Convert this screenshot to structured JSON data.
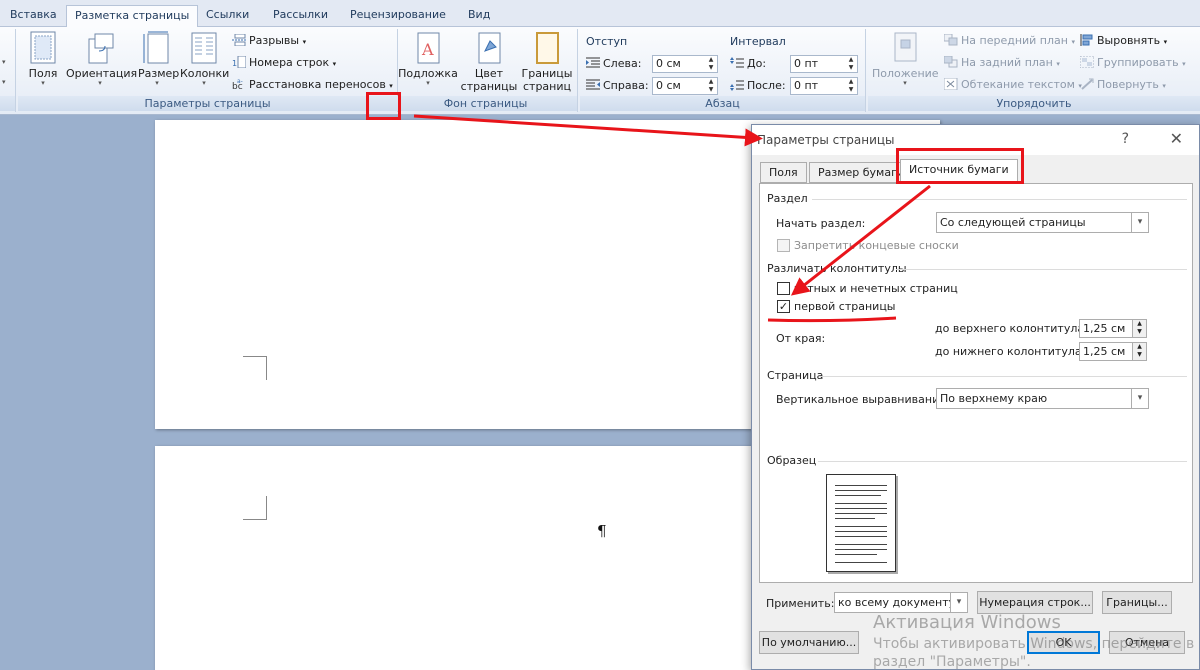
{
  "tabs": [
    "Вставка",
    "Разметка страницы",
    "Ссылки",
    "Рассылки",
    "Рецензирование",
    "Вид"
  ],
  "ribbon": {
    "page_setup": {
      "label": "Параметры страницы",
      "fields": "Поля",
      "orientation": "Ориентация",
      "size": "Размер",
      "columns": "Колонки",
      "breaks": "Разрывы",
      "line_numbers": "Номера строк",
      "hyphenation": "Расстановка переносов"
    },
    "page_background": {
      "label": "Фон страницы",
      "watermark": "Подложка",
      "page_color_1": "Цвет",
      "page_color_2": "страницы",
      "borders_1": "Границы",
      "borders_2": "страниц"
    },
    "paragraph": {
      "label": "Абзац",
      "indent_title": "Отступ",
      "left_label": "Слева:",
      "left_value": "0 см",
      "right_label": "Справа:",
      "right_value": "0 см",
      "spacing_title": "Интервал",
      "before_label": "До:",
      "before_value": "0 пт",
      "after_label": "После:",
      "after_value": "0 пт"
    },
    "arrange": {
      "label": "Упорядочить",
      "position": "Положение",
      "bring_forward": "На передний план",
      "send_backward": "На задний план",
      "text_wrap": "Обтекание текстом",
      "align": "Выровнять",
      "group": "Группировать",
      "rotate": "Повернуть"
    }
  },
  "document": {
    "pilcrow": "¶"
  },
  "dialog": {
    "title": "Параметры страницы",
    "help": "?",
    "close": "✕",
    "tabs": [
      "Поля",
      "Размер бумаги",
      "Источник бумаги"
    ],
    "section_header": "Раздел",
    "start_section_label": "Начать раздел:",
    "start_section_value": "Со следующей страницы",
    "suppress_endnotes_label": "Запретить концевые сноски",
    "headers_header": "Различать колонтитулы",
    "odd_even_label": "четных и нечетных страниц",
    "odd_even_checked": false,
    "first_page_label": "первой страницы",
    "first_page_checked": true,
    "from_edge_label": "От края:",
    "header_dist_label": "до верхнего колонтитула:",
    "header_dist_value": "1,25 см",
    "footer_dist_label": "до нижнего колонтитула:",
    "footer_dist_value": "1,25 см",
    "page_header": "Страница",
    "valign_label": "Вертикальное выравнивание:",
    "valign_value": "По верхнему краю",
    "preview_header": "Образец",
    "apply_label": "Применить:",
    "apply_value": "ко всему документу",
    "line_numbers_button": "Нумерация строк...",
    "borders_button": "Границы...",
    "default_button": "По умолчанию...",
    "ok_button": "OK",
    "cancel_button": "Отмена"
  },
  "watermark": {
    "line1": "Активация Windows",
    "line2": "Чтобы активировать Windows, перейдите в",
    "line3": "раздел \"Параметры\"."
  },
  "annotation_color": "#e8141a"
}
